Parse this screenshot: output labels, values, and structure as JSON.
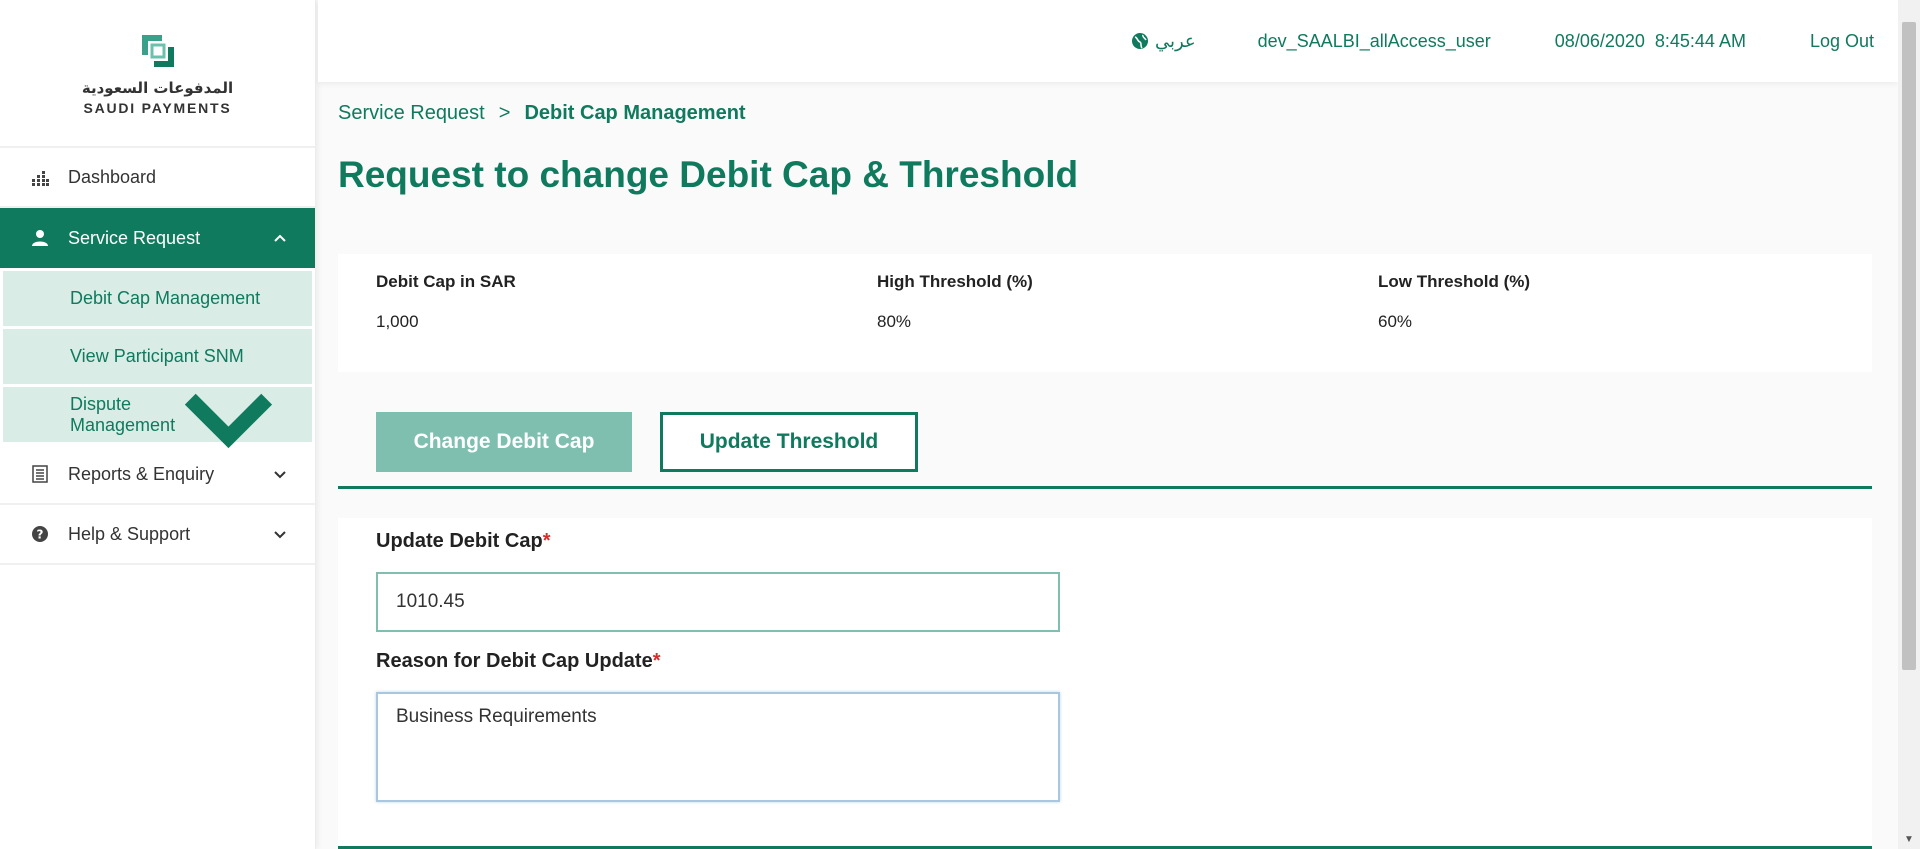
{
  "brand": {
    "name_ar": "المدفوعات السعودية",
    "name_en": "SAUDI PAYMENTS"
  },
  "sidebar": {
    "items": [
      {
        "label": "Dashboard",
        "icon": "dashboard-icon"
      },
      {
        "label": "Service Request",
        "icon": "user-icon",
        "expanded": true,
        "children": [
          {
            "label": "Debit Cap Management"
          },
          {
            "label": "View Participant SNM"
          },
          {
            "label": "Dispute Management"
          }
        ]
      },
      {
        "label": "Reports & Enquiry",
        "icon": "report-icon"
      },
      {
        "label": "Help & Support",
        "icon": "help-icon"
      }
    ]
  },
  "header": {
    "language": "عربي",
    "username": "dev_SAALBI_allAccess_user",
    "datetime": "08/06/2020  8:45:44 AM",
    "logout": "Log Out"
  },
  "breadcrumb": {
    "parent": "Service Request",
    "separator": ">",
    "current": "Debit Cap Management"
  },
  "page": {
    "title": "Request to change Debit Cap & Threshold"
  },
  "summary": [
    {
      "label": "Debit Cap in SAR",
      "value": "1,000"
    },
    {
      "label": "High Threshold (%)",
      "value": "80%"
    },
    {
      "label": "Low Threshold (%)",
      "value": "60%"
    }
  ],
  "tabs": {
    "change_cap": "Change Debit Cap",
    "update_threshold": "Update Threshold"
  },
  "form": {
    "debit_cap_label": "Update Debit Cap",
    "debit_cap_value": "1010.45",
    "reason_label": "Reason for Debit Cap Update",
    "reason_value": "Business Requirements",
    "required_mark": "*"
  },
  "colors": {
    "primary": "#0f7a5d",
    "primary_light": "#7fbfb0",
    "submenu_bg": "#d9ece6",
    "required": "#d32f2f"
  }
}
